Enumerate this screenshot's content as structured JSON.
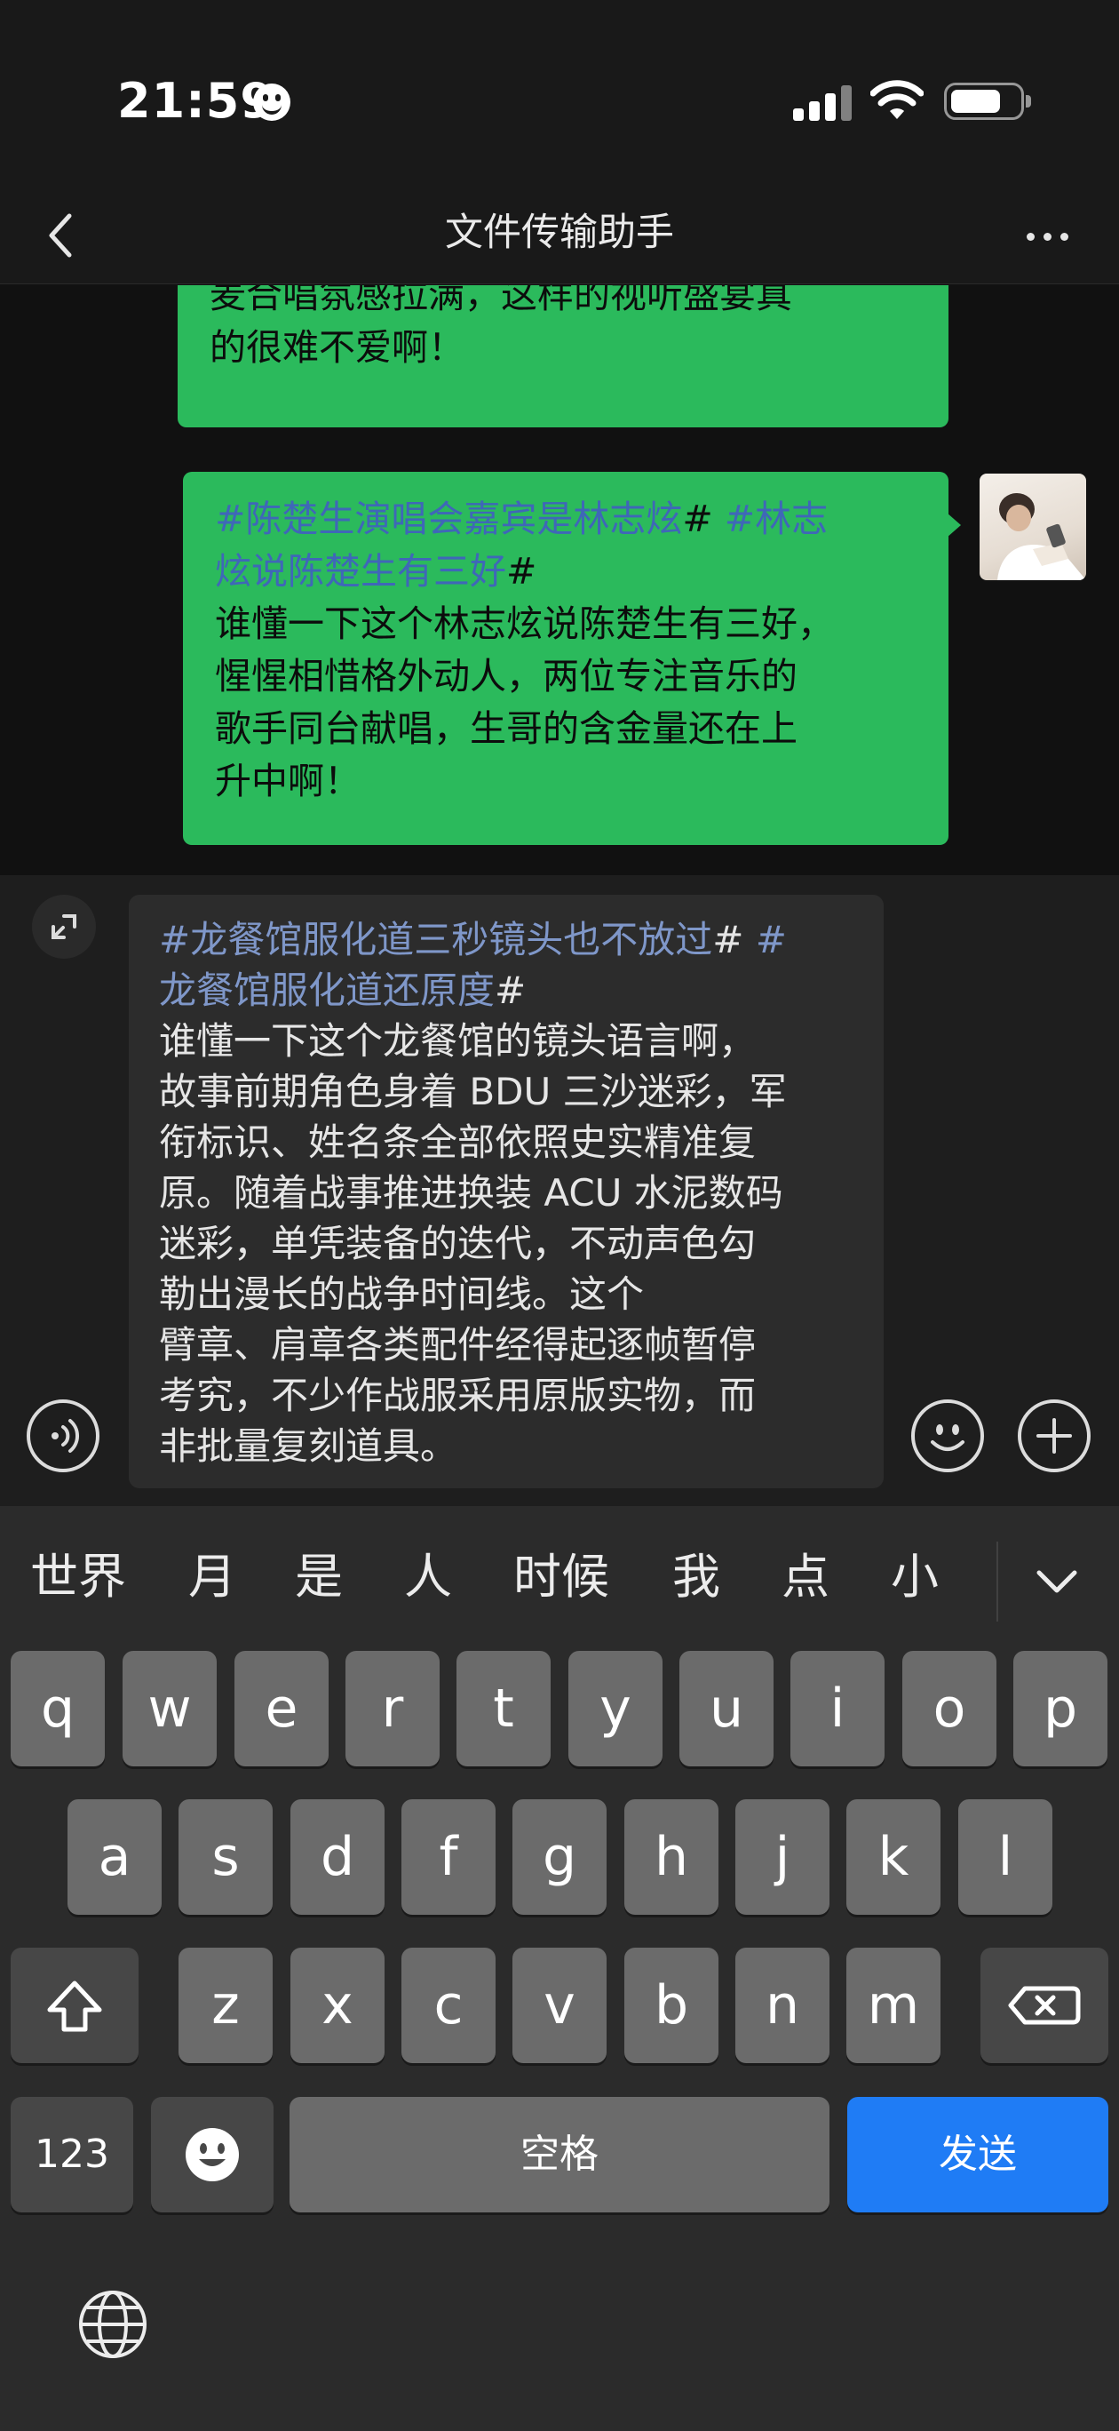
{
  "status_bar": {
    "time": "21:59"
  },
  "nav": {
    "title": "文件传输助手"
  },
  "messages": [
    {
      "partial_line": "麦合唱氛感拉满，这样的视听盛宴真",
      "lines": [
        "麦合唱氛感拉满，这样的视听盛宴真",
        "的很难不爱啊！"
      ]
    },
    {
      "tags": [
        "#陈楚生演唱会嘉宾是林志炫",
        "# ",
        "#林志",
        "炫说陈楚生有三好",
        "#"
      ],
      "body": [
        "谁懂一下这个林志炫说陈楚生有三好，",
        "惺惺相惜格外动人，两位专注音乐的",
        "歌手同台献唱，生哥的含金量还在上",
        "升中啊！"
      ]
    }
  ],
  "composer": {
    "tag_line1": "#龙餐馆服化道三秒镜头也不放过",
    "tag_hash1": "# ",
    "tag_line1b": "#",
    "tag_line2": "龙餐馆服化道还原度",
    "tag_hash2": "#",
    "lines": [
      "谁懂一下这个龙餐馆的镜头语言啊，",
      "故事前期角色身着 BDU 三沙迷彩，军",
      "衔标识、姓名条全部依照史实精准复",
      "原。随着战事推进换装 ACU 水泥数码",
      "迷彩，单凭装备的迭代，不动声色勾",
      "勒出漫长的战争时间线。这个",
      "臂章、肩章各类配件经得起逐帧暂停",
      "考究，不少作战服采用原版实物，而",
      "非批量复刻道具。"
    ]
  },
  "candidates": [
    "世界",
    "月",
    "是",
    "人",
    "时候",
    "我",
    "点",
    "小"
  ],
  "keyboard": {
    "row1": [
      "q",
      "w",
      "e",
      "r",
      "t",
      "y",
      "u",
      "i",
      "o",
      "p"
    ],
    "row2": [
      "a",
      "s",
      "d",
      "f",
      "g",
      "h",
      "j",
      "k",
      "l"
    ],
    "row3": [
      "z",
      "x",
      "c",
      "v",
      "b",
      "n",
      "m"
    ],
    "numbers_label": "123",
    "space_label": "空格",
    "send_label": "发送"
  }
}
